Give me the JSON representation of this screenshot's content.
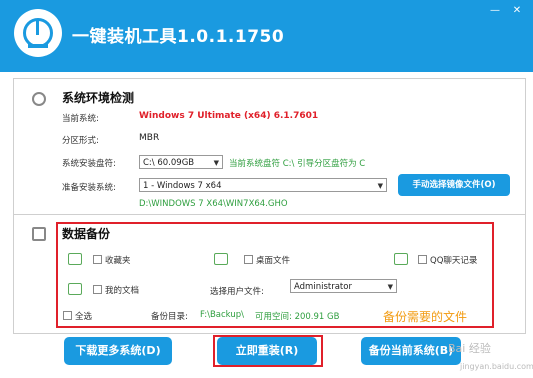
{
  "app": {
    "title": "一键装机工具1.0.1.1750",
    "minimize": "—",
    "close": "✕"
  },
  "env": {
    "title": "系统环境检测",
    "current_system_label": "当前系统:",
    "current_system_value": "Windows 7 Ultimate (x64) 6.1.7601",
    "partition_label": "分区形式:",
    "partition_value": "MBR",
    "install_drive_label": "系统安装盘符:",
    "install_drive_value": "C:\\ 60.09GB",
    "drive_note": "当前系统盘符 C:\\ 引导分区盘符为 C",
    "prepare_label": "准备安装系统:",
    "prepare_value": "1 - Windows 7  x64",
    "manual_button": "手动选择镜像文件(O)",
    "image_path": "D:\\WINDOWS 7 X64\\WIN7X64.GHO"
  },
  "backup": {
    "title": "数据备份",
    "favorites": "收藏夹",
    "desktop": "桌面文件",
    "qq": "QQ聊天记录",
    "documents": "我的文档",
    "user_label": "选择用户文件:",
    "user_value": "Administrator",
    "select_all": "全选",
    "dir_label": "备份目录:",
    "dir_value": "F:\\Backup\\",
    "space_label": "可用空间: 200.91 GB"
  },
  "bottom": {
    "download": "下载更多系统(D)",
    "install": "立即重装(R)",
    "backup_current": "备份当前系统(B)"
  },
  "annotation": "备份需要的文件",
  "watermark": {
    "text": "Bai 经验",
    "url": "jingyan.baidu.com"
  }
}
